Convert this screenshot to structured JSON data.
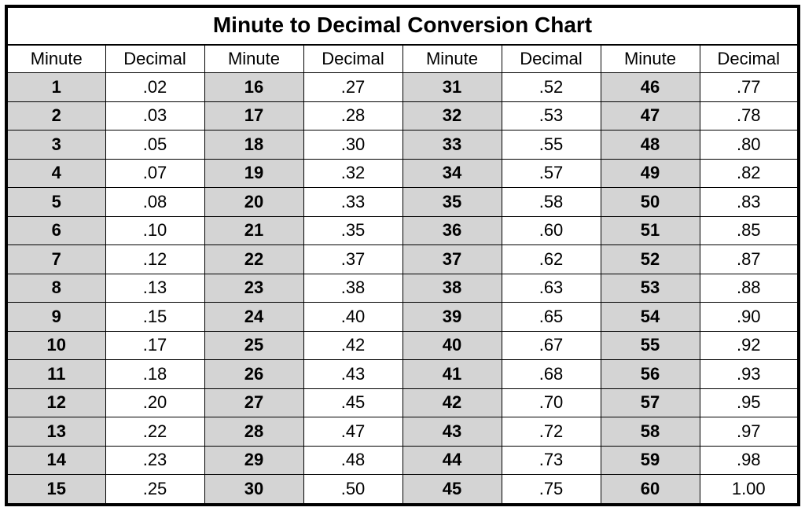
{
  "title": "Minute to Decimal Conversion Chart",
  "headers": {
    "minute": "Minute",
    "decimal": "Decimal"
  },
  "columns": [
    {
      "rows": [
        {
          "minute": "1",
          "decimal": ".02"
        },
        {
          "minute": "2",
          "decimal": ".03"
        },
        {
          "minute": "3",
          "decimal": ".05"
        },
        {
          "minute": "4",
          "decimal": ".07"
        },
        {
          "minute": "5",
          "decimal": ".08"
        },
        {
          "minute": "6",
          "decimal": ".10"
        },
        {
          "minute": "7",
          "decimal": ".12"
        },
        {
          "minute": "8",
          "decimal": ".13"
        },
        {
          "minute": "9",
          "decimal": ".15"
        },
        {
          "minute": "10",
          "decimal": ".17"
        },
        {
          "minute": "11",
          "decimal": ".18"
        },
        {
          "minute": "12",
          "decimal": ".20"
        },
        {
          "minute": "13",
          "decimal": ".22"
        },
        {
          "minute": "14",
          "decimal": ".23"
        },
        {
          "minute": "15",
          "decimal": ".25"
        }
      ]
    },
    {
      "rows": [
        {
          "minute": "16",
          "decimal": ".27"
        },
        {
          "minute": "17",
          "decimal": ".28"
        },
        {
          "minute": "18",
          "decimal": ".30"
        },
        {
          "minute": "19",
          "decimal": ".32"
        },
        {
          "minute": "20",
          "decimal": ".33"
        },
        {
          "minute": "21",
          "decimal": ".35"
        },
        {
          "minute": "22",
          "decimal": ".37"
        },
        {
          "minute": "23",
          "decimal": ".38"
        },
        {
          "minute": "24",
          "decimal": ".40"
        },
        {
          "minute": "25",
          "decimal": ".42"
        },
        {
          "minute": "26",
          "decimal": ".43"
        },
        {
          "minute": "27",
          "decimal": ".45"
        },
        {
          "minute": "28",
          "decimal": ".47"
        },
        {
          "minute": "29",
          "decimal": ".48"
        },
        {
          "minute": "30",
          "decimal": ".50"
        }
      ]
    },
    {
      "rows": [
        {
          "minute": "31",
          "decimal": ".52"
        },
        {
          "minute": "32",
          "decimal": ".53"
        },
        {
          "minute": "33",
          "decimal": ".55"
        },
        {
          "minute": "34",
          "decimal": ".57"
        },
        {
          "minute": "35",
          "decimal": ".58"
        },
        {
          "minute": "36",
          "decimal": ".60"
        },
        {
          "minute": "37",
          "decimal": ".62"
        },
        {
          "minute": "38",
          "decimal": ".63"
        },
        {
          "minute": "39",
          "decimal": ".65"
        },
        {
          "minute": "40",
          "decimal": ".67"
        },
        {
          "minute": "41",
          "decimal": ".68"
        },
        {
          "minute": "42",
          "decimal": ".70"
        },
        {
          "minute": "43",
          "decimal": ".72"
        },
        {
          "minute": "44",
          "decimal": ".73"
        },
        {
          "minute": "45",
          "decimal": ".75"
        }
      ]
    },
    {
      "rows": [
        {
          "minute": "46",
          "decimal": ".77"
        },
        {
          "minute": "47",
          "decimal": ".78"
        },
        {
          "minute": "48",
          "decimal": ".80"
        },
        {
          "minute": "49",
          "decimal": ".82"
        },
        {
          "minute": "50",
          "decimal": ".83"
        },
        {
          "minute": "51",
          "decimal": ".85"
        },
        {
          "minute": "52",
          "decimal": ".87"
        },
        {
          "minute": "53",
          "decimal": ".88"
        },
        {
          "minute": "54",
          "decimal": ".90"
        },
        {
          "minute": "55",
          "decimal": ".92"
        },
        {
          "minute": "56",
          "decimal": ".93"
        },
        {
          "minute": "57",
          "decimal": ".95"
        },
        {
          "minute": "58",
          "decimal": ".97"
        },
        {
          "minute": "59",
          "decimal": ".98"
        },
        {
          "minute": "60",
          "decimal": "1.00"
        }
      ]
    }
  ],
  "chart_data": {
    "type": "table",
    "title": "Minute to Decimal Conversion Chart",
    "xlabel": "Minute",
    "ylabel": "Decimal",
    "x": [
      1,
      2,
      3,
      4,
      5,
      6,
      7,
      8,
      9,
      10,
      11,
      12,
      13,
      14,
      15,
      16,
      17,
      18,
      19,
      20,
      21,
      22,
      23,
      24,
      25,
      26,
      27,
      28,
      29,
      30,
      31,
      32,
      33,
      34,
      35,
      36,
      37,
      38,
      39,
      40,
      41,
      42,
      43,
      44,
      45,
      46,
      47,
      48,
      49,
      50,
      51,
      52,
      53,
      54,
      55,
      56,
      57,
      58,
      59,
      60
    ],
    "values": [
      0.02,
      0.03,
      0.05,
      0.07,
      0.08,
      0.1,
      0.12,
      0.13,
      0.15,
      0.17,
      0.18,
      0.2,
      0.22,
      0.23,
      0.25,
      0.27,
      0.28,
      0.3,
      0.32,
      0.33,
      0.35,
      0.37,
      0.38,
      0.4,
      0.42,
      0.43,
      0.45,
      0.47,
      0.48,
      0.5,
      0.52,
      0.53,
      0.55,
      0.57,
      0.58,
      0.6,
      0.62,
      0.63,
      0.65,
      0.67,
      0.68,
      0.7,
      0.72,
      0.73,
      0.75,
      0.77,
      0.78,
      0.8,
      0.82,
      0.83,
      0.85,
      0.87,
      0.88,
      0.9,
      0.92,
      0.93,
      0.95,
      0.97,
      0.98,
      1.0
    ]
  }
}
